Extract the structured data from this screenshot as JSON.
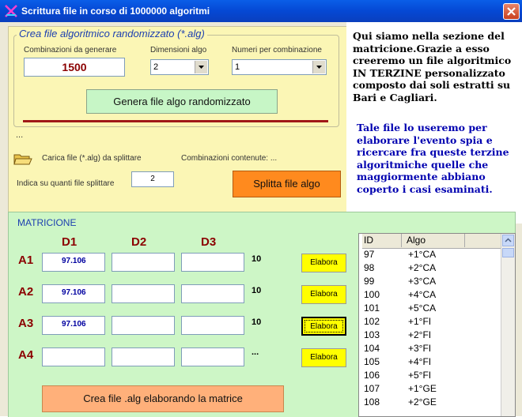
{
  "window": {
    "title": "Scrittura file in corso di 1000000 algoritmi"
  },
  "random_group": {
    "legend": "Crea file algoritmico randomizzato (*.alg)",
    "combinazioni_label": "Combinazioni da generare",
    "combinazioni_value": "1500",
    "dimensioni_label": "Dimensioni algo",
    "dimensioni_value": "2",
    "numeri_label": "Numeri per combinazione",
    "numeri_value": "1",
    "generate_button": "Genera file algo randomizzato"
  },
  "split": {
    "ellipsis": "...",
    "carica_label": "Carica file (*.alg) da splittare",
    "contenute_label": "Combinazioni contenute: ...",
    "indica_label": "Indica su quanti file splittare",
    "indica_value": "2",
    "split_button": "Splitta file algo"
  },
  "info": {
    "p1": "Qui siamo nella sezione del matricione.Grazie a esso creeremo un file algoritmico IN TERZINE personalizzato composto dai soli estratti su Bari e Cagliari.",
    "p2": "Tale file lo useremo per elaborare l'evento spia e ricercare fra queste terzine algoritmiche quelle che maggiormente abbiano coperto i casi esaminati."
  },
  "matrix": {
    "legend": "MATRICIONE",
    "columns": [
      "D1",
      "D2",
      "D3"
    ],
    "rows": [
      {
        "label": "A1",
        "d1": "97.106",
        "d2": "",
        "d3": "",
        "count": "10",
        "button": "Elabora"
      },
      {
        "label": "A2",
        "d1": "97.106",
        "d2": "",
        "d3": "",
        "count": "10",
        "button": "Elabora"
      },
      {
        "label": "A3",
        "d1": "97.106",
        "d2": "",
        "d3": "",
        "count": "10",
        "button": "Elabora"
      },
      {
        "label": "A4",
        "d1": "",
        "d2": "",
        "d3": "",
        "count": "...",
        "button": "Elabora"
      }
    ],
    "create_button": "Crea file .alg elaborando la matrice"
  },
  "table": {
    "headers": [
      "ID",
      "Algo"
    ],
    "rows": [
      [
        "97",
        "+1°CA"
      ],
      [
        "98",
        "+2°CA"
      ],
      [
        "99",
        "+3°CA"
      ],
      [
        "100",
        "+4°CA"
      ],
      [
        "101",
        "+5°CA"
      ],
      [
        "102",
        "+1°FI"
      ],
      [
        "103",
        "+2°FI"
      ],
      [
        "104",
        "+3°FI"
      ],
      [
        "105",
        "+4°FI"
      ],
      [
        "106",
        "+5°FI"
      ],
      [
        "107",
        "+1°GE"
      ],
      [
        "108",
        "+2°GE"
      ]
    ]
  }
}
